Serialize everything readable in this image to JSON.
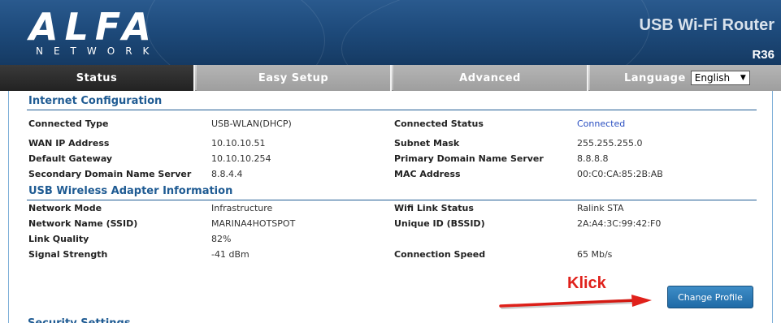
{
  "header": {
    "logo": "ALFA",
    "logo_sub": "NETWORK",
    "product_title": "USB Wi-Fi Router",
    "model": "R36"
  },
  "nav": {
    "tabs": [
      {
        "label": "Status",
        "active": true
      },
      {
        "label": "Easy Setup",
        "active": false
      },
      {
        "label": "Advanced",
        "active": false
      }
    ],
    "language_label": "Language",
    "language_selected": "English"
  },
  "internet_config": {
    "title": "Internet Configuration",
    "rows": [
      {
        "l1": "Connected Type",
        "v1": "USB-WLAN(DHCP)",
        "l2": "Connected Status",
        "v2": "Connected"
      },
      {
        "l1": "WAN IP Address",
        "v1": "10.10.10.51",
        "l2": "Subnet Mask",
        "v2": "255.255.255.0"
      },
      {
        "l1": "Default Gateway",
        "v1": "10.10.10.254",
        "l2": "Primary Domain Name Server",
        "v2": "8.8.8.8"
      },
      {
        "l1": "Secondary Domain Name Server",
        "v1": "8.8.4.4",
        "l2": "MAC Address",
        "v2": "00:C0:CA:85:2B:AB"
      }
    ]
  },
  "wireless_adapter": {
    "title": "USB Wireless Adapter Information",
    "rows": [
      {
        "l1": "Network Mode",
        "v1": "Infrastructure",
        "l2": "Wifi Link Status",
        "v2": "Ralink STA"
      },
      {
        "l1": "Network Name (SSID)",
        "v1": "MARINA4HOTSPOT",
        "l2": "Unique ID (BSSID)",
        "v2": "2A:A4:3C:99:42:F0"
      },
      {
        "l1": "Link Quality",
        "v1": "82%",
        "l2": "",
        "v2": ""
      },
      {
        "l1": "Signal Strength",
        "v1": "-41 dBm",
        "l2": "Connection Speed",
        "v2": "65 Mb/s"
      }
    ]
  },
  "annotation": {
    "klick": "Klick",
    "arrow_color": "#e0211b"
  },
  "actions": {
    "change_profile": "Change Profile"
  },
  "partial_section_title": "Security Settings",
  "colors": {
    "header_bg": "#1e4b7c",
    "section_title": "#1f5b93",
    "connected": "#2a4fc1",
    "button": "#1f6aa6"
  }
}
